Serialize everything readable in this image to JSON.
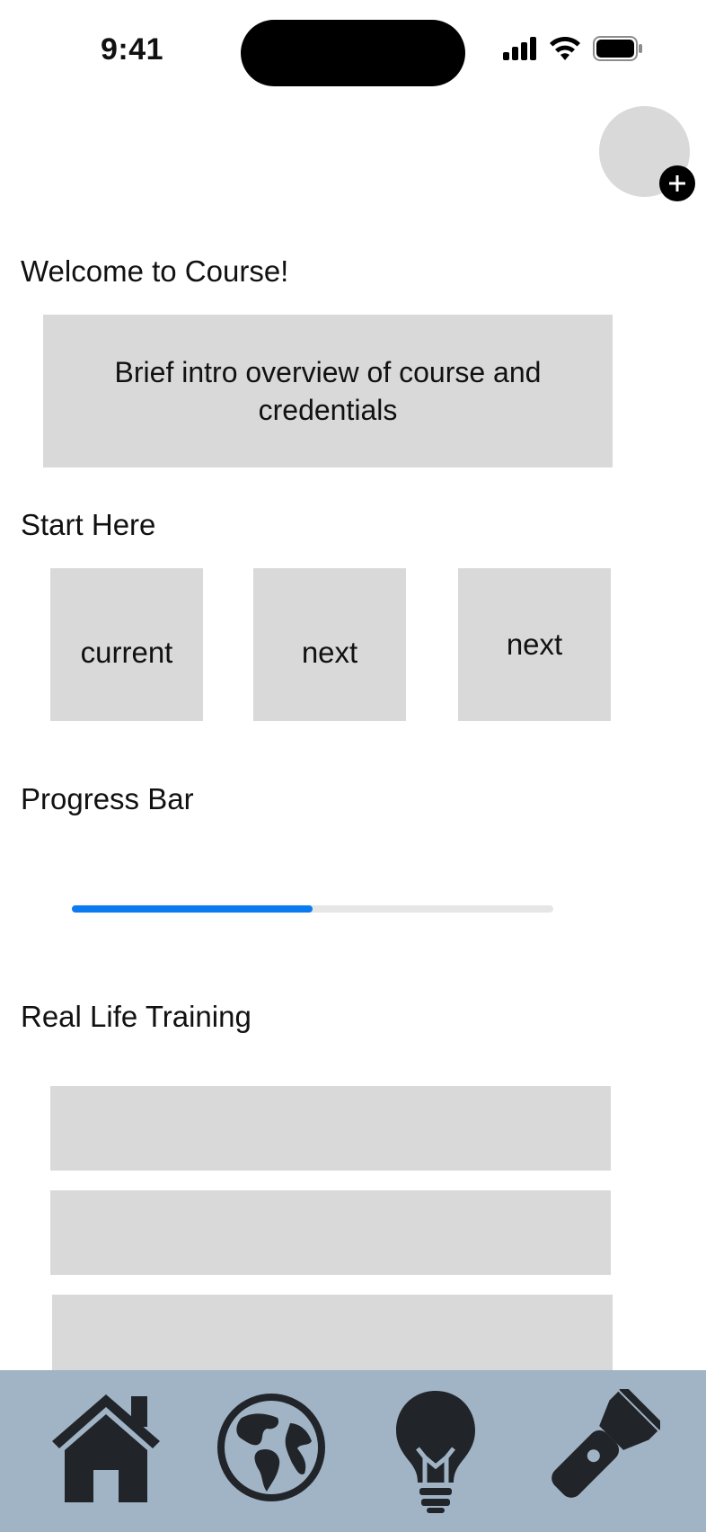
{
  "status_bar": {
    "time": "9:41"
  },
  "header": {
    "avatar": "profile-avatar",
    "add_icon": "plus-icon"
  },
  "welcome": {
    "title": "Welcome to Course!",
    "intro": "Brief intro overview of course and credentials"
  },
  "start": {
    "title": "Start Here",
    "steps": [
      {
        "label": "current"
      },
      {
        "label": "next"
      },
      {
        "label": "next"
      }
    ]
  },
  "progress": {
    "title": "Progress Bar",
    "fraction": 0.5,
    "fill_color": "#0b7bf0"
  },
  "training": {
    "title": "Real Life Training",
    "items": 3
  },
  "tab_bar": {
    "background": "#a1b4c6",
    "icons": [
      "home-icon",
      "globe-icon",
      "lightbulb-icon",
      "flashlight-icon"
    ]
  }
}
